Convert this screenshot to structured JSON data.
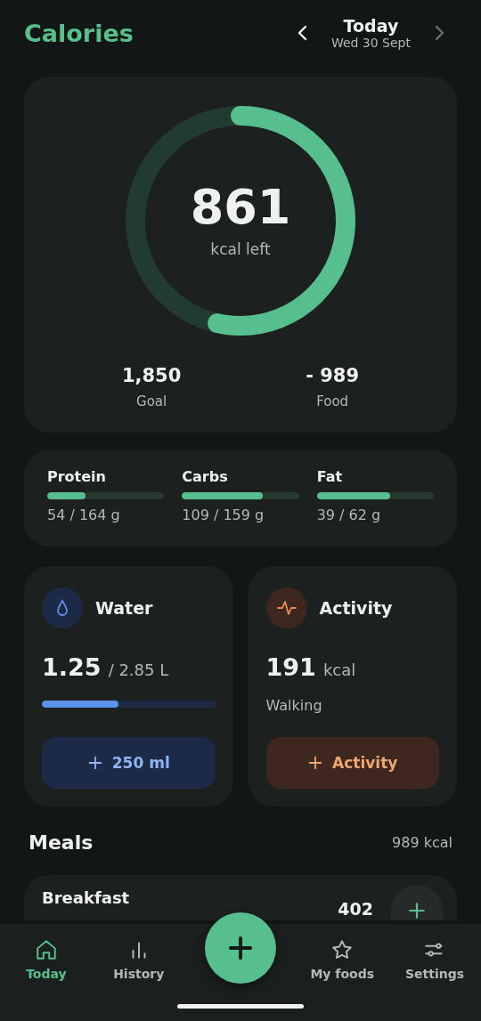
{
  "header": {
    "title": "Calories",
    "day": "Today",
    "date": "Wed 30 Sept",
    "next_disabled": true
  },
  "summary": {
    "remaining": "861",
    "remaining_label": "kcal left",
    "level": 0.535,
    "stats": [
      {
        "value": "1,850",
        "label": "Goal"
      },
      {
        "value": "- 989",
        "label": "Food"
      }
    ]
  },
  "macros": [
    {
      "name": "Protein",
      "reading": "54 / 164 g",
      "level": 0.33
    },
    {
      "name": "Carbs",
      "reading": "109 / 159 g",
      "level": 0.69
    },
    {
      "name": "Fat",
      "reading": "39 / 62 g",
      "level": 0.63
    }
  ],
  "water": {
    "title": "Water",
    "amount": "1.25",
    "target": "/ 2.85 L",
    "level": 0.44,
    "button": "250 ml"
  },
  "activity": {
    "title": "Activity",
    "amount": "191",
    "unit": "kcal",
    "detail": "Walking",
    "button": "Activity"
  },
  "meals": {
    "title": "Meals",
    "total": "989 kcal",
    "items": [
      {
        "name": "Breakfast",
        "kcal": "402"
      }
    ]
  },
  "nav": [
    {
      "label": "Today",
      "selected": true
    },
    {
      "label": "History",
      "selected": false
    },
    {
      "label": "My foods",
      "selected": false
    },
    {
      "label": "Settings",
      "selected": false
    }
  ]
}
